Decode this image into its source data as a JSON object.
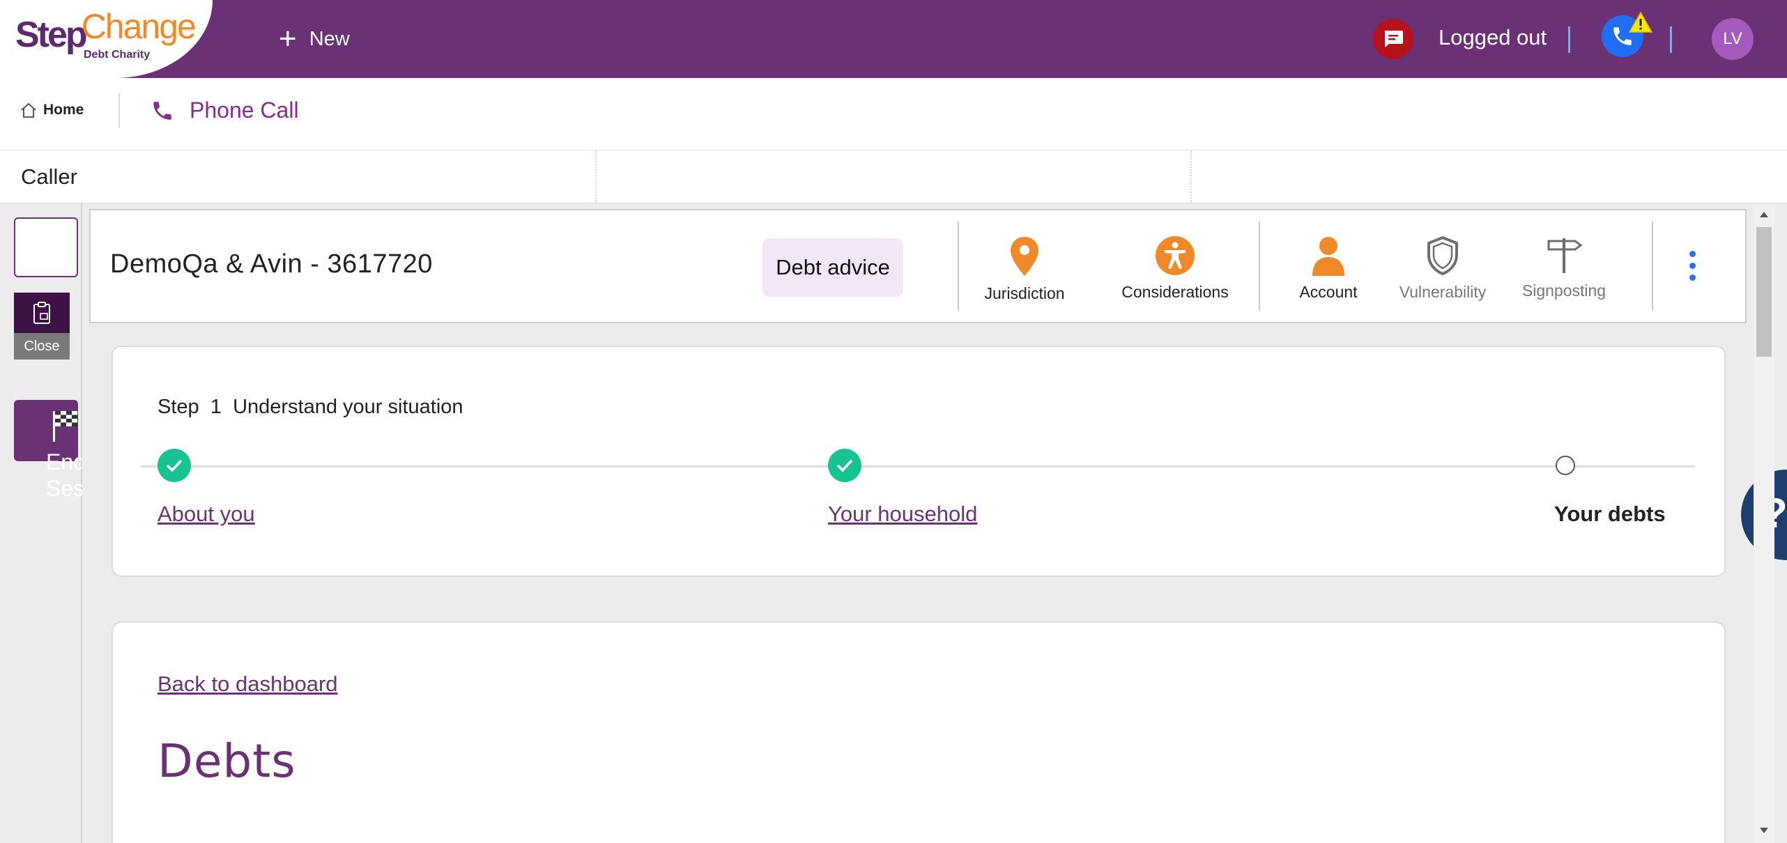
{
  "colors": {
    "brand_purple": "#6a3175",
    "accent_orange": "#f0892a",
    "link_purple": "#6a3175",
    "success_green": "#18c392",
    "alert_red": "#b5121b",
    "phone_blue": "#1e6ff5",
    "help_navy": "#1d3f70"
  },
  "topbar": {
    "logo": {
      "step": "Step",
      "change": "Change",
      "subtitle": "Debt Charity"
    },
    "new_label": "New",
    "status": "Logged out",
    "avatar_initials": "LV",
    "icons": [
      "chat-icon",
      "phone-icon",
      "warning-icon"
    ]
  },
  "tabs": {
    "home": "Home",
    "phone_call": "Phone Call"
  },
  "caller": {
    "label": "Caller"
  },
  "leftrail": {
    "close_label": "Close",
    "end_session_label": "End Session"
  },
  "case_header": {
    "title": "DemoQa & Avin - 3617720",
    "advice_badge": "Debt advice",
    "actions": [
      {
        "key": "jurisdiction",
        "label": "Jurisdiction",
        "icon": "map-pin-icon",
        "active": true
      },
      {
        "key": "considerations",
        "label": "Considerations",
        "icon": "accessibility-icon",
        "active": true
      },
      {
        "key": "account",
        "label": "Account",
        "icon": "person-icon",
        "active": true
      },
      {
        "key": "vulnerability",
        "label": "Vulnerability",
        "icon": "shield-icon",
        "active": false
      },
      {
        "key": "signposting",
        "label": "Signposting",
        "icon": "signpost-icon",
        "active": false
      }
    ]
  },
  "steps": {
    "step_word": "Step",
    "step_number": "1",
    "step_name": "Understand your situation",
    "items": [
      {
        "label": "About you",
        "state": "complete"
      },
      {
        "label": "Your household",
        "state": "complete"
      },
      {
        "label": "Your debts",
        "state": "current"
      }
    ]
  },
  "debts": {
    "back_link": "Back to dashboard",
    "heading": "Debts"
  },
  "help": {
    "label": "?"
  }
}
